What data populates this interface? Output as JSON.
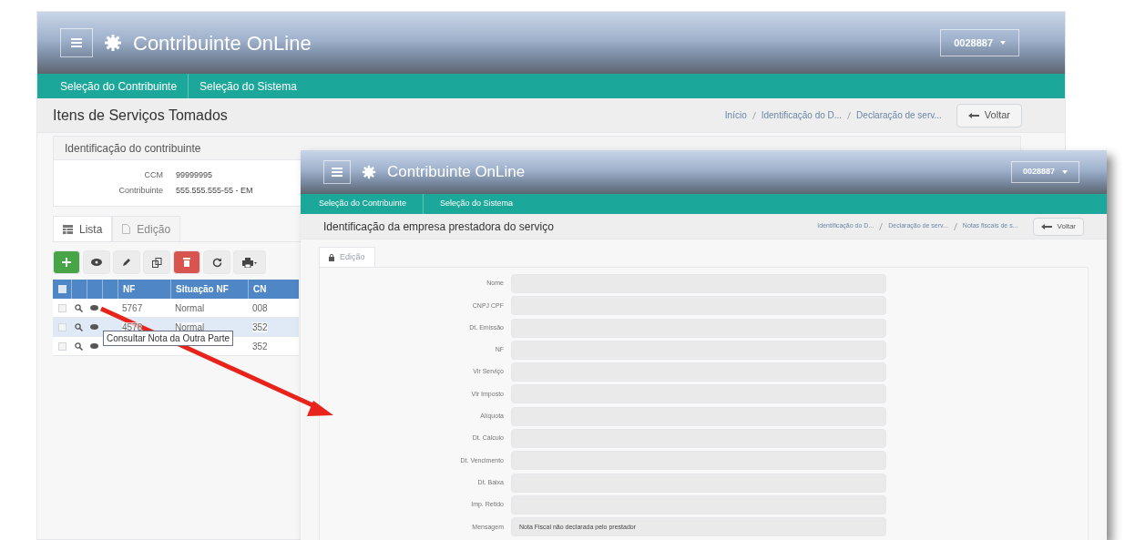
{
  "back_window": {
    "app_title": "Contribuinte OnLine",
    "user_button": "0028887",
    "nav": [
      "Seleção do Contribuinte",
      "Seleção do Sistema"
    ],
    "page_title": "Itens de Serviços Tomados",
    "breadcrumbs": [
      "Início",
      "Identificação do D...",
      "Declaração de serv..."
    ],
    "back_button": "Voltar",
    "contributor_panel": {
      "title": "Identificação do contribuinte",
      "fields": [
        {
          "label": "CCM",
          "value": "99999995"
        },
        {
          "label": "Contribuinte",
          "value": "555.555.555-55 - EM"
        }
      ]
    },
    "tabs": [
      {
        "label": "Lista",
        "kind": "list",
        "selected": true
      },
      {
        "label": "Edição",
        "kind": "edit",
        "selected": false
      }
    ],
    "toolbar": [
      {
        "kind": "add"
      },
      {
        "kind": "view"
      },
      {
        "kind": "edit"
      },
      {
        "kind": "copy"
      },
      {
        "kind": "delete"
      },
      {
        "kind": "refresh"
      },
      {
        "kind": "print"
      }
    ],
    "table": {
      "select_all_checked": false,
      "columns": [
        "NF",
        "Situação NF",
        "CN"
      ],
      "rows": [
        {
          "selected": false,
          "checked": false,
          "nf": "5767",
          "situacao": "Normal",
          "column_3": "008"
        },
        {
          "selected": true,
          "checked": false,
          "nf": "4578",
          "situacao": "Normal",
          "column_3": "352"
        },
        {
          "selected": false,
          "checked": false,
          "column_3": "352"
        }
      ]
    },
    "tooltip": "Consultar Nota da Outra Parte"
  },
  "front_window": {
    "app_title": "Contribuinte OnLine",
    "user_button": "0028887",
    "nav": [
      "Seleção do Contribuinte",
      "Seleção do Sistema"
    ],
    "page_title": "Identificação da empresa prestadora do serviço",
    "breadcrumbs": [
      "Identificação do D...",
      "Declaração de serv...",
      "Notas fiscais de s..."
    ],
    "back_button": "Voltar",
    "tab": "Edição",
    "fields": [
      {
        "label": "Nome"
      },
      {
        "label": "CNPJ CPF"
      },
      {
        "label": "Dt. Emissão"
      },
      {
        "label": "NF"
      },
      {
        "label": "Vlr Serviço"
      },
      {
        "label": "Vlr Imposto"
      },
      {
        "label": "Alíquota"
      },
      {
        "label": "Dt. Cálculo"
      },
      {
        "label": "Dt. Vencimento"
      },
      {
        "label": "Dt. Baixa"
      },
      {
        "label": "Imp. Retido"
      },
      {
        "label": "Mensagem",
        "value": "Nota Fiscal não declarada pelo prestador"
      }
    ]
  }
}
